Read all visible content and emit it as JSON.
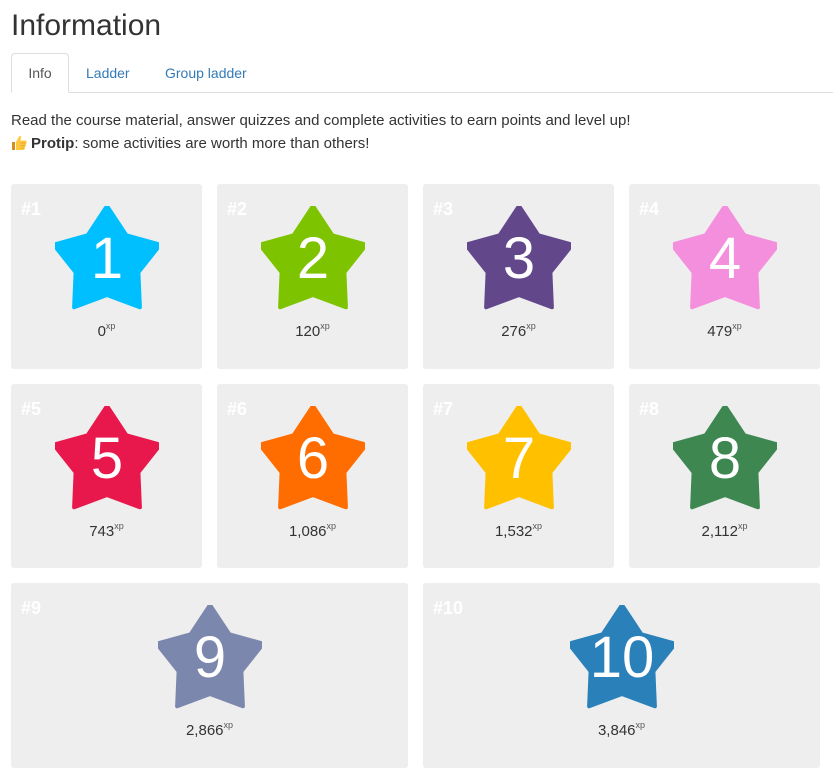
{
  "page": {
    "title": "Information"
  },
  "tabs": [
    {
      "label": "Info",
      "active": true
    },
    {
      "label": "Ladder",
      "active": false
    },
    {
      "label": "Group ladder",
      "active": false
    }
  ],
  "intro": {
    "description": "Read the course material, answer quizzes and complete activities to earn points and level up!",
    "protip_icon": "thumbs-up-icon",
    "protip_label": "Protip",
    "protip_text": ": some activities are worth more than others!"
  },
  "xp_unit": "xp",
  "levels": [
    {
      "rank": "#1",
      "number": "1",
      "xp": "0",
      "color": "#00bfff"
    },
    {
      "rank": "#2",
      "number": "2",
      "xp": "120",
      "color": "#7ec300"
    },
    {
      "rank": "#3",
      "number": "3",
      "xp": "276",
      "color": "#63478b"
    },
    {
      "rank": "#4",
      "number": "4",
      "xp": "479",
      "color": "#f48fde"
    },
    {
      "rank": "#5",
      "number": "5",
      "xp": "743",
      "color": "#e8174c"
    },
    {
      "rank": "#6",
      "number": "6",
      "xp": "1,086",
      "color": "#ff6c00"
    },
    {
      "rank": "#7",
      "number": "7",
      "xp": "1,532",
      "color": "#ffc000"
    },
    {
      "rank": "#8",
      "number": "8",
      "xp": "2,112",
      "color": "#3e8751"
    },
    {
      "rank": "#9",
      "number": "9",
      "xp": "2,866",
      "color": "#7b87ad"
    },
    {
      "rank": "#10",
      "number": "10",
      "xp": "3,846",
      "color": "#2a80b9"
    }
  ]
}
